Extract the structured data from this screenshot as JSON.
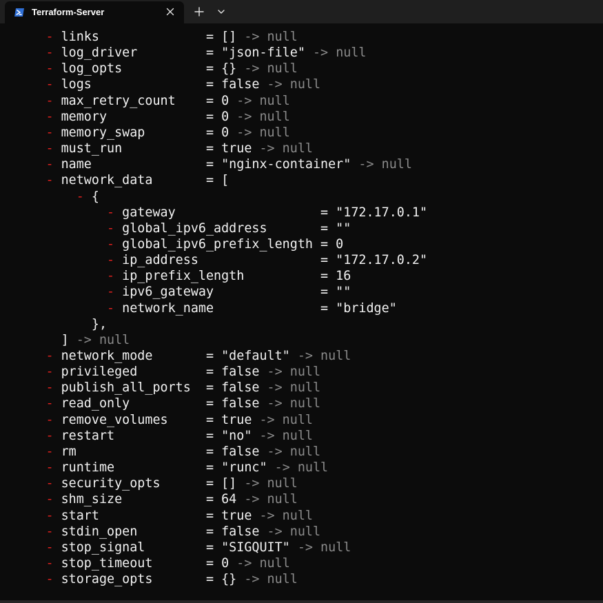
{
  "window": {
    "tab_title": "Terraform-Server",
    "tab_icon": "powershell-icon",
    "close_icon": "close-icon",
    "new_tab_icon": "plus-icon",
    "dropdown_icon": "chevron-down-icon"
  },
  "colors": {
    "background": "#0c0c0c",
    "titlebar": "#1f1f1f",
    "text": "#f2f2f2",
    "removed_marker": "#e0201e",
    "dim_text": "#8a8a8a"
  },
  "terminal": {
    "lines": [
      {
        "indent": "      ",
        "marker": "-",
        "text": " links              = []",
        "suffix": " -> null"
      },
      {
        "indent": "      ",
        "marker": "-",
        "text": " log_driver         = \"json-file\"",
        "suffix": " -> null"
      },
      {
        "indent": "      ",
        "marker": "-",
        "text": " log_opts           = {}",
        "suffix": " -> null"
      },
      {
        "indent": "      ",
        "marker": "-",
        "text": " logs               = false",
        "suffix": " -> null"
      },
      {
        "indent": "      ",
        "marker": "-",
        "text": " max_retry_count    = 0",
        "suffix": " -> null"
      },
      {
        "indent": "      ",
        "marker": "-",
        "text": " memory             = 0",
        "suffix": " -> null"
      },
      {
        "indent": "      ",
        "marker": "-",
        "text": " memory_swap        = 0",
        "suffix": " -> null"
      },
      {
        "indent": "      ",
        "marker": "-",
        "text": " must_run           = true",
        "suffix": " -> null"
      },
      {
        "indent": "      ",
        "marker": "-",
        "text": " name               = \"nginx-container\"",
        "suffix": " -> null"
      },
      {
        "indent": "      ",
        "marker": "-",
        "text": " network_data       = [",
        "suffix": ""
      },
      {
        "indent": "          ",
        "marker": "-",
        "text": " {",
        "suffix": ""
      },
      {
        "indent": "              ",
        "marker": "-",
        "text": " gateway                   = \"172.17.0.1\"",
        "suffix": ""
      },
      {
        "indent": "              ",
        "marker": "-",
        "text": " global_ipv6_address       = \"\"",
        "suffix": ""
      },
      {
        "indent": "              ",
        "marker": "-",
        "text": " global_ipv6_prefix_length = 0",
        "suffix": ""
      },
      {
        "indent": "              ",
        "marker": "-",
        "text": " ip_address                = \"172.17.0.2\"",
        "suffix": ""
      },
      {
        "indent": "              ",
        "marker": "-",
        "text": " ip_prefix_length          = 16",
        "suffix": ""
      },
      {
        "indent": "              ",
        "marker": "-",
        "text": " ipv6_gateway              = \"\"",
        "suffix": ""
      },
      {
        "indent": "              ",
        "marker": "-",
        "text": " network_name              = \"bridge\"",
        "suffix": ""
      },
      {
        "indent": "            ",
        "marker": "",
        "text": "},",
        "suffix": ""
      },
      {
        "indent": "        ",
        "marker": "",
        "text": "]",
        "suffix": " -> null"
      },
      {
        "indent": "      ",
        "marker": "-",
        "text": " network_mode       = \"default\"",
        "suffix": " -> null"
      },
      {
        "indent": "      ",
        "marker": "-",
        "text": " privileged         = false",
        "suffix": " -> null"
      },
      {
        "indent": "      ",
        "marker": "-",
        "text": " publish_all_ports  = false",
        "suffix": " -> null"
      },
      {
        "indent": "      ",
        "marker": "-",
        "text": " read_only          = false",
        "suffix": " -> null"
      },
      {
        "indent": "      ",
        "marker": "-",
        "text": " remove_volumes     = true",
        "suffix": " -> null"
      },
      {
        "indent": "      ",
        "marker": "-",
        "text": " restart            = \"no\"",
        "suffix": " -> null"
      },
      {
        "indent": "      ",
        "marker": "-",
        "text": " rm                 = false",
        "suffix": " -> null"
      },
      {
        "indent": "      ",
        "marker": "-",
        "text": " runtime            = \"runc\"",
        "suffix": " -> null"
      },
      {
        "indent": "      ",
        "marker": "-",
        "text": " security_opts      = []",
        "suffix": " -> null"
      },
      {
        "indent": "      ",
        "marker": "-",
        "text": " shm_size           = 64",
        "suffix": " -> null"
      },
      {
        "indent": "      ",
        "marker": "-",
        "text": " start              = true",
        "suffix": " -> null"
      },
      {
        "indent": "      ",
        "marker": "-",
        "text": " stdin_open         = false",
        "suffix": " -> null"
      },
      {
        "indent": "      ",
        "marker": "-",
        "text": " stop_signal        = \"SIGQUIT\"",
        "suffix": " -> null"
      },
      {
        "indent": "      ",
        "marker": "-",
        "text": " stop_timeout       = 0",
        "suffix": " -> null"
      },
      {
        "indent": "      ",
        "marker": "-",
        "text": " storage_opts       = {}",
        "suffix": " -> null"
      }
    ]
  }
}
